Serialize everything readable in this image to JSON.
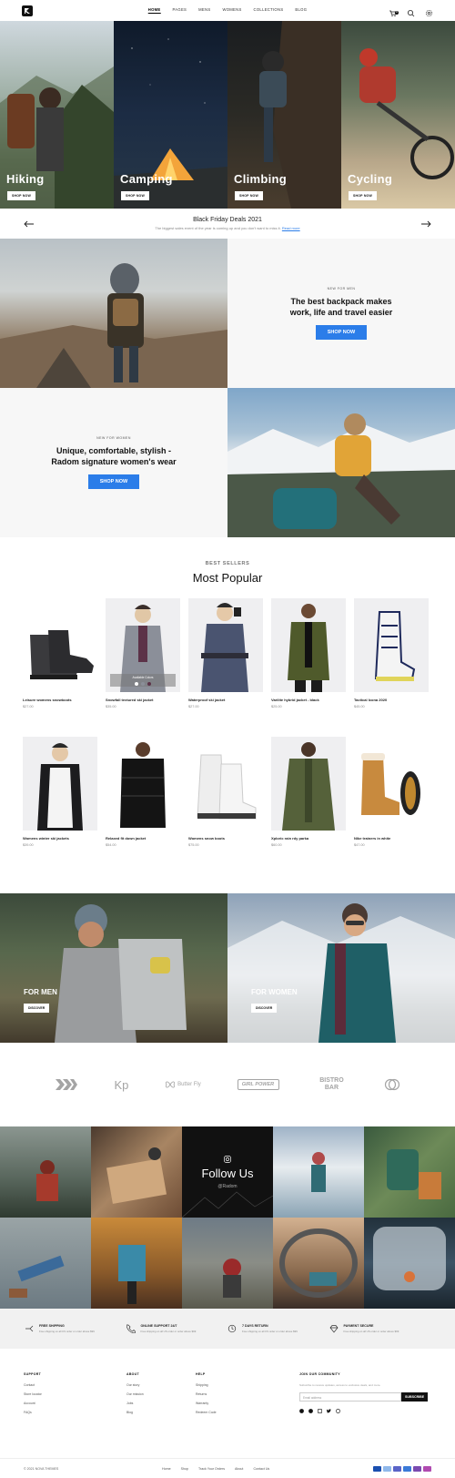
{
  "nav": [
    "HOME",
    "PAGES",
    "MENS",
    "WOMENS",
    "COLLECTIONS",
    "BLOG"
  ],
  "cart_count": "0",
  "hero": [
    {
      "title": "Hiking",
      "button": "SHOP NOW"
    },
    {
      "title": "Camping",
      "button": "SHOP NOW"
    },
    {
      "title": "Climbing",
      "button": "SHOP NOW"
    },
    {
      "title": "Cycling",
      "button": "SHOP NOW"
    }
  ],
  "deals": {
    "title": "Black Friday Deals 2021",
    "text": "The biggest sales event of the year is coming up and you don't want to miss it.",
    "link": "Read more"
  },
  "promo_men": {
    "kicker": "NEW FOR MEN",
    "heading": "The best backpack makes work, life and travel easier",
    "button": "SHOP NOW"
  },
  "promo_women": {
    "kicker": "NEW FOR WOMEN",
    "heading": "Unique, comfortable, stylish - Radom signature women's wear",
    "button": "SHOP NOW"
  },
  "best": {
    "kicker": "BEST SELLERS",
    "title": "Most Popular"
  },
  "products": [
    {
      "name": "Leisure womens snowboots",
      "price": "$27.00"
    },
    {
      "name": "Snowfall textured ski jacket",
      "price": "$35.00",
      "overlay": "Available Colors"
    },
    {
      "name": "Waterproof ski jacket",
      "price": "$27.00"
    },
    {
      "name": "Varilite hybrid jacket - black",
      "price": "$25.00"
    },
    {
      "name": "Tactical Icona 2020",
      "price": "$45.00"
    },
    {
      "name": "Womens winter ski jackets",
      "price": "$39.00"
    },
    {
      "name": "Relaxed fit down jacket",
      "price": "$54.00"
    },
    {
      "name": "Womens snow boots",
      "price": "$75.00"
    },
    {
      "name": "Xploric rain rdy parka",
      "price": "$60.00"
    },
    {
      "name": "Nike trainers in white",
      "price": "$47.00"
    }
  ],
  "men_banner": {
    "label": "FOR MEN",
    "button": "DISCOVER"
  },
  "women_banner": {
    "label": "FOR WOMEN",
    "button": "DISCOVER"
  },
  "brands": [
    "",
    "Kp",
    "Butter Fly",
    "GIRL POWER",
    "BISTRO BAR",
    ""
  ],
  "instagram": {
    "title": "Follow Us",
    "handle": "@Radom"
  },
  "features": [
    {
      "title": "FREE SHIPPING",
      "desc": "Free shipping on all US order or order above $99"
    },
    {
      "title": "ONLINE SUPPORT 24/7",
      "desc": "Free shipping on all US order or order above $99"
    },
    {
      "title": "7 DAYS RETURN",
      "desc": "Free shipping on all US order or order above $99"
    },
    {
      "title": "PAYMENT SECURE",
      "desc": "Free shipping on all US order or order above $99"
    }
  ],
  "footer": {
    "support": {
      "title": "SUPPORT",
      "links": [
        "Contact",
        "Store locator",
        "Account",
        "FAQs"
      ]
    },
    "about": {
      "title": "ABOUT",
      "links": [
        "Our story",
        "Our mission",
        "Jobs",
        "Blog"
      ]
    },
    "help": {
      "title": "HELP",
      "links": [
        "Shipping",
        "Returns",
        "Warranty",
        "Redeem Code"
      ]
    },
    "join": {
      "title": "JOIN OUR COMMUNITY",
      "text": "Subscribe to receive updates, access to exclusive deals, and more.",
      "placeholder": "Email address",
      "button": "SUBSCRIBE"
    },
    "copyright": "© 2021 NOVA THEMES",
    "bottom_links": [
      "Home",
      "Shop",
      "Track Your Orders",
      "About",
      "Contact Us"
    ]
  },
  "colors": {
    "accent": "#2b7de9",
    "dark": "#111111",
    "bg_soft": "#f7f7f7"
  }
}
